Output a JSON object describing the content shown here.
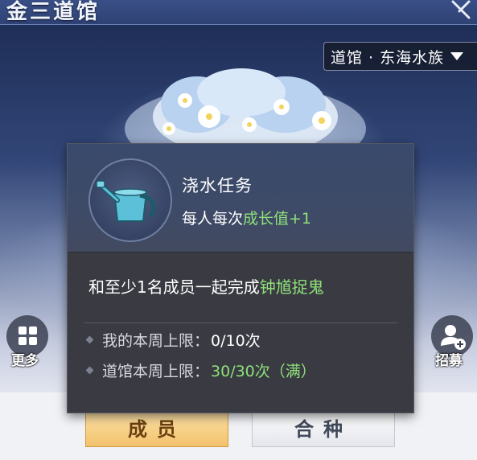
{
  "header": {
    "title": "金三道馆"
  },
  "gym_selector": {
    "label": "道馆 · 东海水族"
  },
  "side_buttons": {
    "more_label": "更多",
    "recruit_label": "招募"
  },
  "popup": {
    "title": "浇水任务",
    "reward_prefix": "每人每次",
    "reward_highlight": "成长值+1",
    "description_prefix": "和至少1名成员一起完成",
    "description_highlight": "钟馗捉鬼",
    "limits": [
      {
        "label": "我的本周上限：",
        "value": "0/10次"
      },
      {
        "label": "道馆本周上限：",
        "value": "30/30次（满）"
      }
    ]
  },
  "tabs": {
    "member_label": "成员",
    "breed_label": "合种"
  },
  "colors": {
    "highlight_green": "#8ee07a",
    "panel_bg": "#3a3b42",
    "tab_active": "#f2c26c"
  }
}
